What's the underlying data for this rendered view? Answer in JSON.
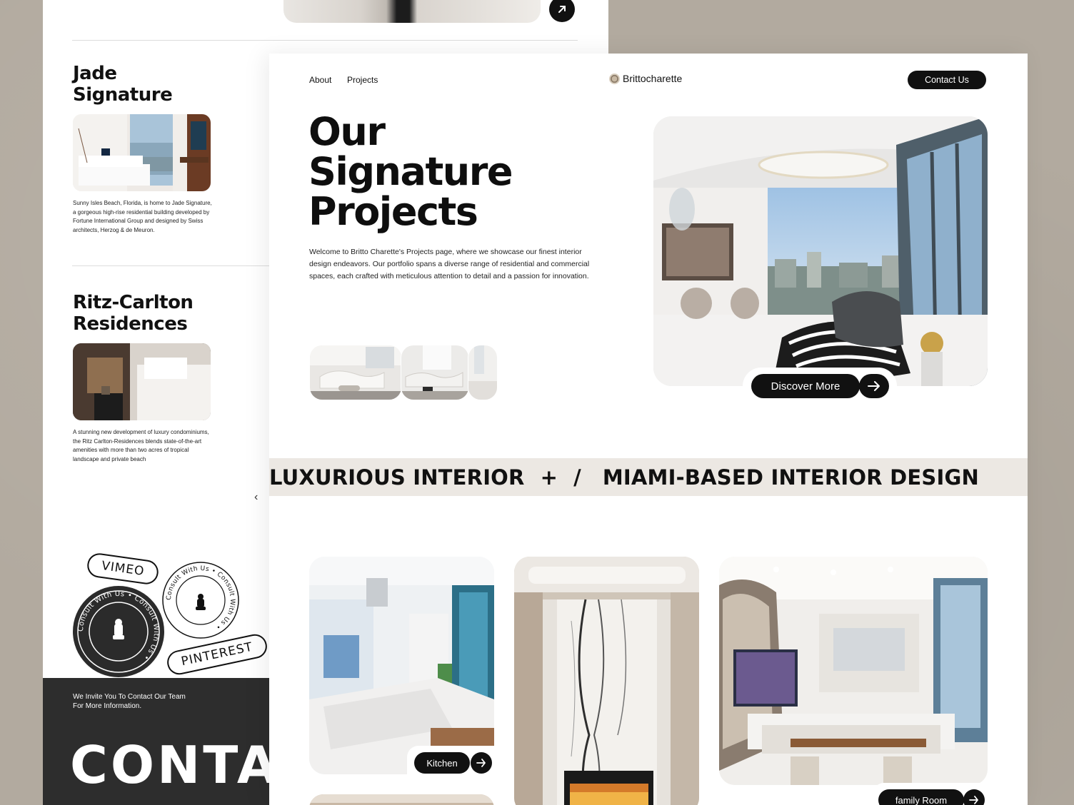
{
  "back_page": {
    "projects": [
      {
        "title_line1": "Jade",
        "title_line2": "Signature",
        "description": "Sunny Isles Beach, Florida, is home to Jade Signature, a gorgeous high-rise residential building developed by Fortune International Group and designed by Swiss architects, Herzog & de Meuron."
      },
      {
        "title_line1": "Ritz-Carlton",
        "title_line2": "Residences",
        "description": "A stunning new development of luxury condominiums, the Ritz Carlton-Residences blends state-of-the-art amenities with more than two acres of tropical landscape and private beach"
      }
    ],
    "social": {
      "vimeo": "VIMEO",
      "pinterest": "PINTEREST",
      "badge_text": "Consult With Us • Consult With Us • "
    },
    "contact": {
      "invite": "We Invite You To Contact Our Team For More Information.",
      "big_text": "CONTA"
    }
  },
  "nav": {
    "about": "About",
    "projects": "Projects",
    "brand": "Brittocharette",
    "contact_button": "Contact Us"
  },
  "hero": {
    "title_line1": "Our",
    "title_line2": "Signature",
    "title_line3": "Projects",
    "description": "Welcome to Britto Charette's Projects page, where we showcase our finest interior design endeavors. Our portfolio spans a diverse range of residential and commercial spaces, each crafted with meticulous attention to detail and a passion for innovation.",
    "discover_button": "Discover More"
  },
  "marquee": {
    "item1": "LUXURIOUS INTERIOR",
    "sep1": "+",
    "sep2": "/",
    "item2": "MIAMI-BASED INTERIOR DESIGN"
  },
  "gallery": {
    "kitchen_label": "Kitchen",
    "family_room_label": "family Room"
  },
  "colors": {
    "background": "#b2aa9f",
    "primary": "#111111",
    "marquee_band": "#ece8e3",
    "contact_band": "#2d2d2d"
  }
}
